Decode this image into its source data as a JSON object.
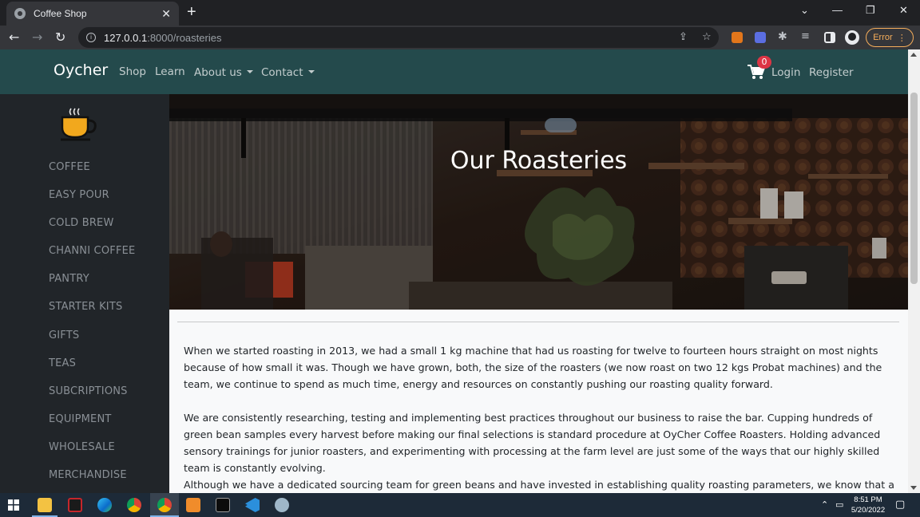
{
  "browser": {
    "tab_title": "Coffee Shop",
    "tab_close": "✕",
    "new_tab": "+",
    "url_host": "127.0.0.1",
    "url_path": ":8000/roasteries",
    "error_label": "Error",
    "win_minimize": "—",
    "win_restore": "❐",
    "win_close": "✕",
    "tab_search": "⌄"
  },
  "site": {
    "brand": "Oycher",
    "nav": {
      "shop": "Shop",
      "learn": "Learn",
      "about": "About us",
      "contact": "Contact",
      "login": "Login",
      "register": "Register"
    },
    "cart_count": "0",
    "sidebar": [
      "COFFEE",
      "EASY POUR",
      "COLD BREW",
      "CHANNI COFFEE",
      "PANTRY",
      "STARTER KITS",
      "GIFTS",
      "TEAS",
      "SUBCRIPTIONS",
      "EQUIPMENT",
      "WHOLESALE",
      "MERCHANDISE"
    ],
    "hero_title": "Our Roasteries",
    "paragraphs": [
      "When we started roasting in 2013, we had a small 1 kg machine that had us roasting for twelve to fourteen hours straight on most nights because of how small it was. Though we have grown, both, the size of the roasters (we now roast on two 12 kgs Probat machines) and the team, we continue to spend as much time, energy and resources on constantly pushing our roasting quality forward.",
      "We are consistently researching, testing and implementing best practices throughout our business to raise the bar. Cupping hundreds of green bean samples every harvest before making our final selections is standard procedure at OyCher Coffee Roasters. Holding advanced sensory trainings for junior roasters, and experimenting with processing at the farm level are just some of the ways that our highly skilled team is constantly evolving.",
      "Although we have a dedicated sourcing team for green beans and have invested in establishing quality roasting parameters, we know that a lot"
    ]
  },
  "taskbar": {
    "time": "8:51 PM",
    "date": "5/20/2022"
  },
  "colors": {
    "navbar": "#244a4c",
    "sidebar": "#212529",
    "badge": "#dc3545",
    "cup": "#f2a81d"
  }
}
